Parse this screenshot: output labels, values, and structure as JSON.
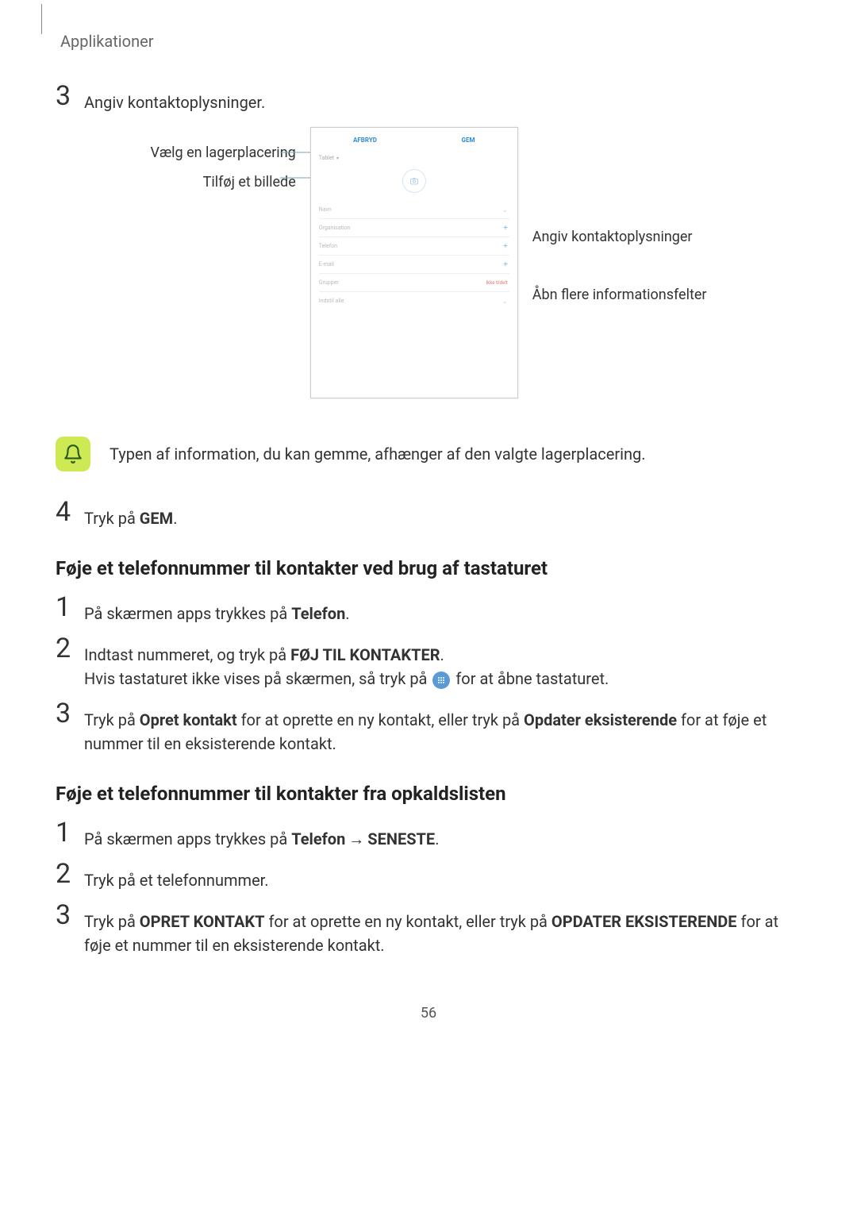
{
  "header": {
    "section": "Applikationer"
  },
  "step3": {
    "text": "Angiv kontaktoplysninger."
  },
  "figure": {
    "left_label_1": "Vælg en lagerplacering",
    "left_label_2": "Tilføj et billede",
    "right_label_1": "Angiv kontaktoplysninger",
    "right_label_2": "Åbn flere informationsfelter",
    "mock": {
      "top_left": "AFBRYD",
      "top_right": "GEM",
      "storage": "Tablet",
      "fields": [
        "Navn",
        "Organisation",
        "Telefon",
        "E-mail",
        "Grupper",
        "Indstil alle"
      ],
      "grupper_right": "Ikke tildelt"
    }
  },
  "note": {
    "text": "Typen af information, du kan gemme, afhænger af den valgte lagerplacering."
  },
  "step4": {
    "prefix": "Tryk på ",
    "bold": "GEM",
    "suffix": "."
  },
  "heading_keypad": "Føje et telefonnummer til kontakter ved brug af tastaturet",
  "k1": {
    "prefix": "På skærmen apps trykkes på ",
    "bold": "Telefon",
    "suffix": "."
  },
  "k2": {
    "line1_prefix": "Indtast nummeret, og tryk på ",
    "line1_bold": "FØJ TIL KONTAKTER",
    "line1_suffix": ".",
    "line2_prefix": "Hvis tastaturet ikke vises på skærmen, så tryk på ",
    "line2_suffix": " for at åbne tastaturet."
  },
  "k3": {
    "p1": "Tryk på ",
    "b1": "Opret kontakt",
    "p2": " for at oprette en ny kontakt, eller tryk på ",
    "b2": "Opdater eksisterende",
    "p3": " for at føje et nummer til en eksisterende kontakt."
  },
  "heading_calllog": "Føje et telefonnummer til kontakter fra opkaldslisten",
  "c1": {
    "prefix": "På skærmen apps trykkes på ",
    "bold1": "Telefon",
    "arrow": "→",
    "bold2": "SENESTE",
    "suffix": "."
  },
  "c2": {
    "text": "Tryk på et telefonnummer."
  },
  "c3": {
    "p1": "Tryk på ",
    "b1": "OPRET KONTAKT",
    "p2": " for at oprette en ny kontakt, eller tryk på ",
    "b2": "OPDATER EKSISTERENDE",
    "p3": " for at føje et nummer til en eksisterende kontakt."
  },
  "page_number": "56"
}
